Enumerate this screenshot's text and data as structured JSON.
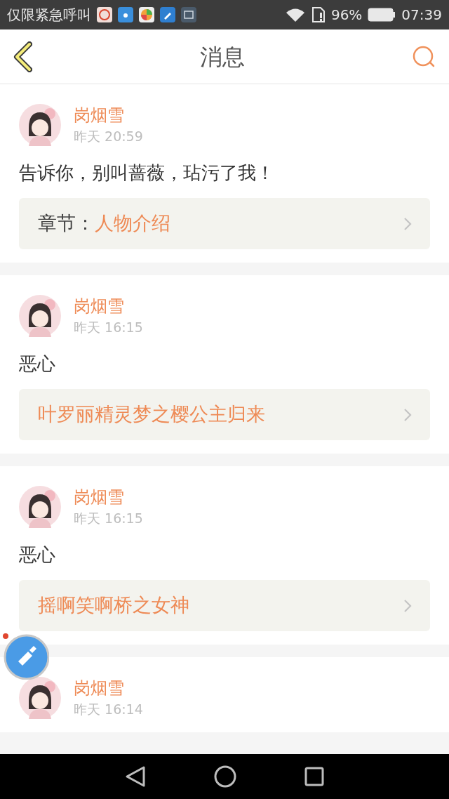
{
  "status_bar": {
    "carrier": "仅限紧急呼叫",
    "battery": "96%",
    "time": "07:39"
  },
  "header": {
    "title": "消息"
  },
  "messages": [
    {
      "user": "岗烟雪",
      "time": "昨天 20:59",
      "text": "告诉你，别叫蔷薇，玷污了我！",
      "link": {
        "label": "章节：",
        "title": "人物介绍"
      }
    },
    {
      "user": "岗烟雪",
      "time": "昨天 16:15",
      "text": "恶心",
      "link": {
        "title": "叶罗丽精灵梦之樱公主归来"
      }
    },
    {
      "user": "岗烟雪",
      "time": "昨天 16:15",
      "text": "恶心",
      "link": {
        "title": "摇啊笑啊桥之女神"
      }
    },
    {
      "user": "岗烟雪",
      "time": "昨天 16:14"
    }
  ]
}
